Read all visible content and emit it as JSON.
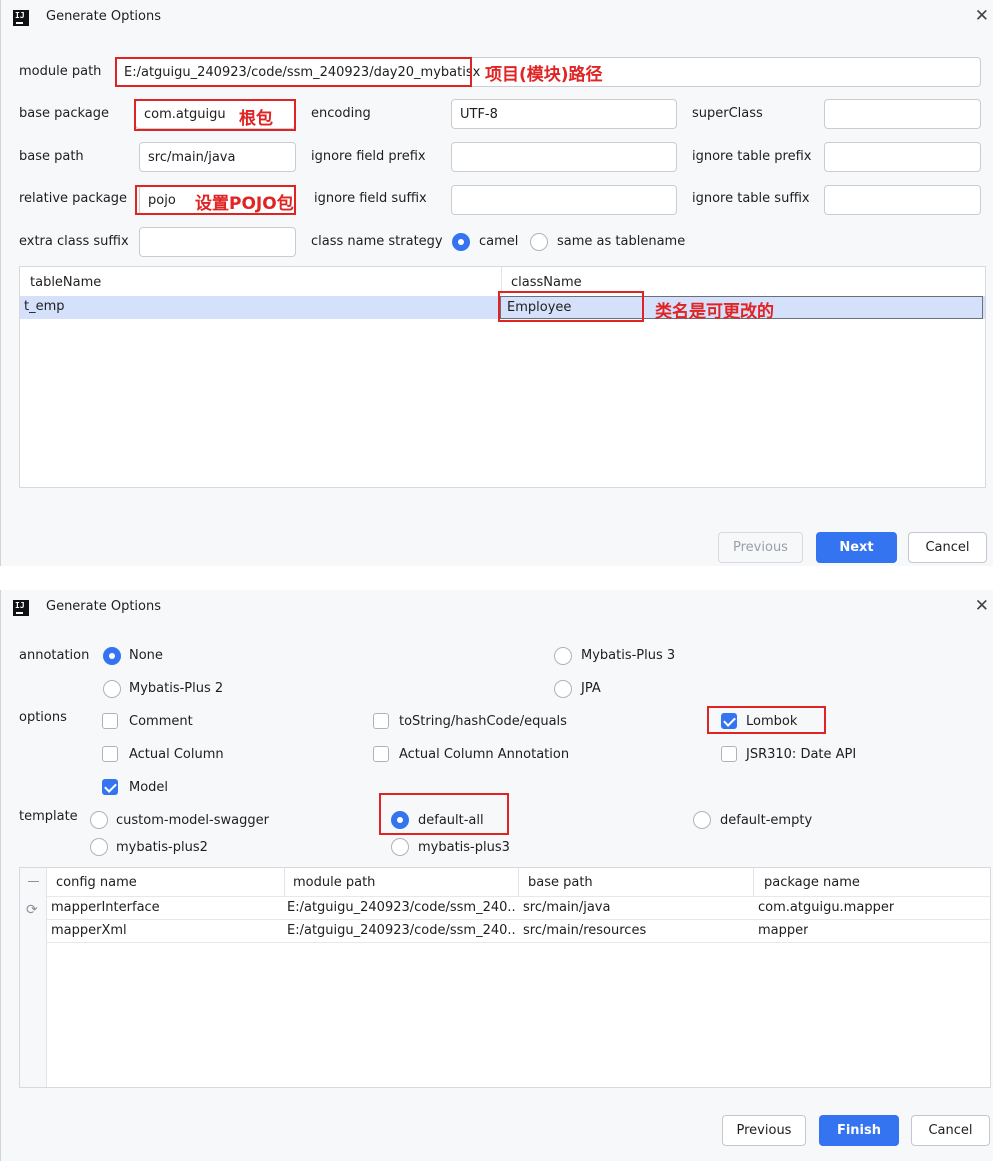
{
  "dialog1": {
    "title": "Generate Options",
    "module_path": {
      "label": "module path",
      "value": "E:/atguigu_240923/code/ssm_240923/day20_mybatisx"
    },
    "base_package": {
      "label": "base package",
      "value": "com.atguigu"
    },
    "encoding": {
      "label": "encoding",
      "value": "UTF-8"
    },
    "super_class": {
      "label": "superClass",
      "value": ""
    },
    "base_path": {
      "label": "base path",
      "value": "src/main/java"
    },
    "ignore_field_prefix": {
      "label": "ignore field prefix",
      "value": ""
    },
    "ignore_table_prefix": {
      "label": "ignore table prefix",
      "value": ""
    },
    "relative_package": {
      "label": "relative package",
      "value": "pojo"
    },
    "ignore_field_suffix": {
      "label": "ignore field suffix",
      "value": ""
    },
    "ignore_table_suffix": {
      "label": "ignore table suffix",
      "value": ""
    },
    "extra_class_suffix": {
      "label": "extra class suffix",
      "value": ""
    },
    "class_name_strategy": {
      "label": "class name strategy",
      "options": [
        "camel",
        "same as tablename"
      ],
      "selected": "camel"
    },
    "table": {
      "headers": [
        "tableName",
        "className"
      ],
      "rows": [
        {
          "table_name": "t_emp",
          "class_name": "Employee"
        }
      ]
    },
    "annotations": {
      "module_path": "项目(模块)路径",
      "base_package": "根包",
      "relative_package": "设置POJO包",
      "class_name": "类名是可更改的"
    },
    "buttons": {
      "previous": "Previous",
      "next": "Next",
      "cancel": "Cancel"
    }
  },
  "dialog2": {
    "title": "Generate Options",
    "annotation": {
      "label": "annotation",
      "options": [
        "None",
        "Mybatis-Plus 3",
        "Mybatis-Plus 2",
        "JPA"
      ],
      "selected": "None"
    },
    "options": {
      "label": "options",
      "items": [
        {
          "label": "Comment",
          "checked": false
        },
        {
          "label": "toString/hashCode/equals",
          "checked": false
        },
        {
          "label": "Lombok",
          "checked": true
        },
        {
          "label": "Actual Column",
          "checked": false
        },
        {
          "label": "Actual Column Annotation",
          "checked": false
        },
        {
          "label": "JSR310: Date API",
          "checked": false
        },
        {
          "label": "Model",
          "checked": true
        }
      ]
    },
    "template": {
      "label": "template",
      "options": [
        "custom-model-swagger",
        "default-all",
        "default-empty",
        "mybatis-plus2",
        "mybatis-plus3"
      ],
      "selected": "default-all"
    },
    "table": {
      "headers": [
        "config name",
        "module path",
        "base path",
        "package name"
      ],
      "rows": [
        {
          "config_name": "mapperInterface",
          "module_path": "E:/atguigu_240923/code/ssm_240...",
          "base_path": "src/main/java",
          "package_name": "com.atguigu.mapper"
        },
        {
          "config_name": "mapperXml",
          "module_path": "E:/atguigu_240923/code/ssm_240...",
          "base_path": "src/main/resources",
          "package_name": "mapper"
        }
      ]
    },
    "buttons": {
      "previous": "Previous",
      "finish": "Finish",
      "cancel": "Cancel"
    }
  },
  "colors": {
    "accent": "#3574f0",
    "annotation_red": "#e02424",
    "selection": "#d5e1fa"
  }
}
